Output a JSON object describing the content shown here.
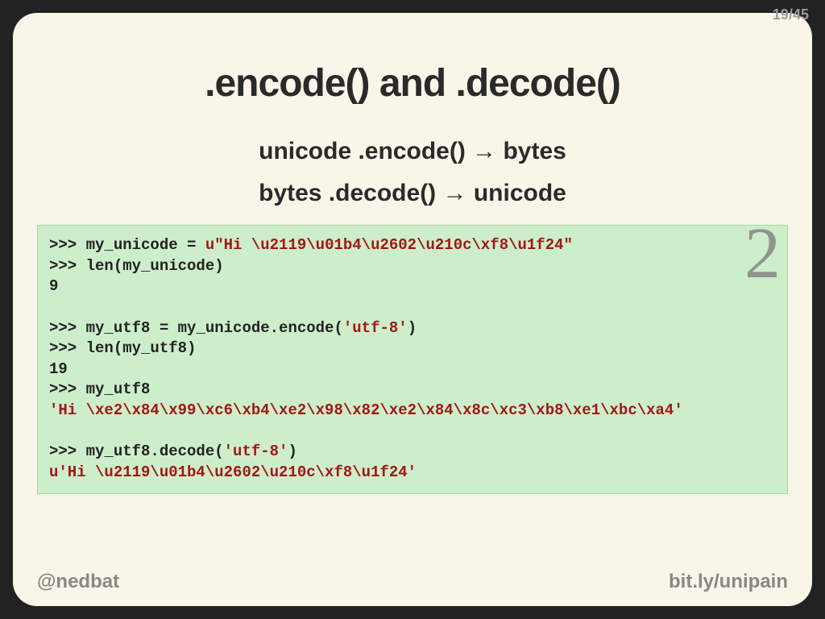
{
  "pager": {
    "current": "19",
    "sep": "/",
    "total": "45"
  },
  "title": ".encode() and .decode()",
  "subtitles": {
    "line1": "unicode .encode() → bytes",
    "line2": "bytes .decode() → unicode"
  },
  "code": {
    "py_badge": "2",
    "l1_prompt": ">>> my_unicode = ",
    "l1_str": "u\"Hi \\u2119\\u01b4\\u2602\\u210c\\xf8\\u1f24\"",
    "l2": ">>> len(my_unicode)",
    "l3": "9",
    "blank1": "",
    "l4_prompt": ">>> my_utf8 = my_unicode.encode(",
    "l4_str": "'utf-8'",
    "l4_end": ")",
    "l5": ">>> len(my_utf8)",
    "l6": "19",
    "l7": ">>> my_utf8",
    "l8": "'Hi \\xe2\\x84\\x99\\xc6\\xb4\\xe2\\x98\\x82\\xe2\\x84\\x8c\\xc3\\xb8\\xe1\\xbc\\xa4'",
    "blank2": "",
    "l9_prompt": ">>> my_utf8.decode(",
    "l9_str": "'utf-8'",
    "l9_end": ")",
    "l10": "u'Hi \\u2119\\u01b4\\u2602\\u210c\\xf8\\u1f24'"
  },
  "footer": {
    "left": "@nedbat",
    "right": "bit.ly/unipain"
  }
}
